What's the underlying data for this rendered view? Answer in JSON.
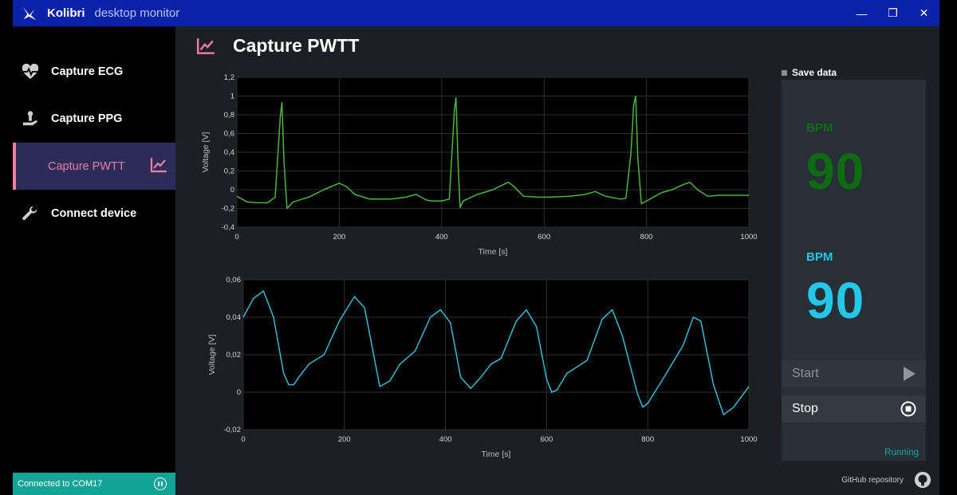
{
  "app": {
    "name": "Kolibri",
    "subtitle": "desktop monitor",
    "minimize": "—",
    "maximize": "❐",
    "close": "✕"
  },
  "sidebar": {
    "items": [
      {
        "label": "Capture ECG",
        "icon": "heart-pulse-icon"
      },
      {
        "label": "Capture PPG",
        "icon": "hand-sensor-icon"
      },
      {
        "label": "Capture PWTT",
        "icon": "line-chart-icon"
      },
      {
        "label": "Connect device",
        "icon": "wrench-icon"
      }
    ],
    "active_index": 2,
    "status": "Connected to COM17"
  },
  "page": {
    "title": "Capture PWTT",
    "icon": "line-chart-icon"
  },
  "chart_data": [
    {
      "type": "line",
      "title": "",
      "xlabel": "Time [s]",
      "ylabel": "Voltage [V]",
      "xlim": [
        0,
        1000
      ],
      "ylim": [
        -0.4,
        1.2
      ],
      "xticks": [
        0,
        200,
        400,
        600,
        800,
        1000
      ],
      "yticks": [
        "1,2",
        "1",
        "0,8",
        "0,6",
        "0,4",
        "0,2",
        "0",
        "-0,2",
        "-0,4"
      ],
      "color": "#4bb63f",
      "grid": true,
      "x": [
        0,
        20,
        40,
        60,
        75,
        85,
        88,
        92,
        98,
        110,
        140,
        170,
        200,
        215,
        230,
        260,
        300,
        330,
        350,
        370,
        380,
        400,
        415,
        425,
        428,
        432,
        436,
        442,
        470,
        500,
        530,
        540,
        560,
        590,
        610,
        650,
        680,
        700,
        720,
        750,
        760,
        770,
        775,
        779,
        783,
        790,
        830,
        850,
        870,
        885,
        900,
        920,
        940,
        970,
        1000
      ],
      "y": [
        -0.07,
        -0.13,
        -0.14,
        -0.14,
        -0.08,
        0.8,
        0.93,
        0.3,
        -0.2,
        -0.13,
        -0.08,
        0.0,
        0.07,
        0.03,
        -0.05,
        -0.1,
        -0.1,
        -0.08,
        -0.05,
        -0.11,
        -0.12,
        -0.12,
        -0.1,
        0.85,
        0.98,
        0.3,
        -0.19,
        -0.12,
        -0.05,
        0.0,
        0.08,
        0.04,
        -0.07,
        -0.08,
        -0.08,
        -0.07,
        -0.05,
        -0.02,
        -0.07,
        -0.1,
        -0.09,
        0.4,
        0.9,
        1.0,
        0.35,
        -0.15,
        -0.03,
        0.0,
        0.05,
        0.08,
        0.0,
        -0.07,
        -0.06,
        -0.06,
        -0.06
      ]
    },
    {
      "type": "line",
      "title": "",
      "xlabel": "Time [s]",
      "ylabel": "Voltage [V]",
      "xlim": [
        0,
        1000
      ],
      "ylim": [
        -0.02,
        0.06
      ],
      "xticks": [
        0,
        200,
        400,
        600,
        800,
        1000
      ],
      "yticks": [
        "0,06",
        "0,04",
        "0,02",
        "0",
        "-0,02"
      ],
      "color": "#33bbd4",
      "grid": true,
      "x": [
        0,
        20,
        40,
        60,
        80,
        90,
        100,
        110,
        130,
        160,
        190,
        220,
        240,
        270,
        290,
        310,
        340,
        370,
        390,
        410,
        430,
        450,
        470,
        490,
        510,
        540,
        560,
        580,
        600,
        610,
        620,
        640,
        680,
        710,
        730,
        750,
        780,
        790,
        800,
        830,
        870,
        890,
        905,
        930,
        950,
        970,
        1000
      ],
      "y": [
        0.04,
        0.05,
        0.054,
        0.04,
        0.01,
        0.004,
        0.004,
        0.008,
        0.015,
        0.02,
        0.038,
        0.051,
        0.045,
        0.003,
        0.006,
        0.015,
        0.022,
        0.04,
        0.044,
        0.037,
        0.008,
        0.002,
        0.008,
        0.015,
        0.018,
        0.038,
        0.044,
        0.035,
        0.007,
        0.0,
        0.001,
        0.01,
        0.017,
        0.039,
        0.044,
        0.03,
        -0.001,
        -0.008,
        -0.006,
        0.007,
        0.025,
        0.04,
        0.038,
        0.004,
        -0.012,
        -0.008,
        0.003
      ]
    }
  ],
  "controls": {
    "save_data": "Save data",
    "bpm1": {
      "label": "BPM",
      "value": "90",
      "color": "#0e6b12"
    },
    "bpm2": {
      "label": "BPM",
      "value": "90",
      "color": "#24c8e6"
    },
    "start": "Start",
    "stop": "Stop",
    "status": "Running"
  },
  "footer": {
    "github": "GitHub repository"
  }
}
